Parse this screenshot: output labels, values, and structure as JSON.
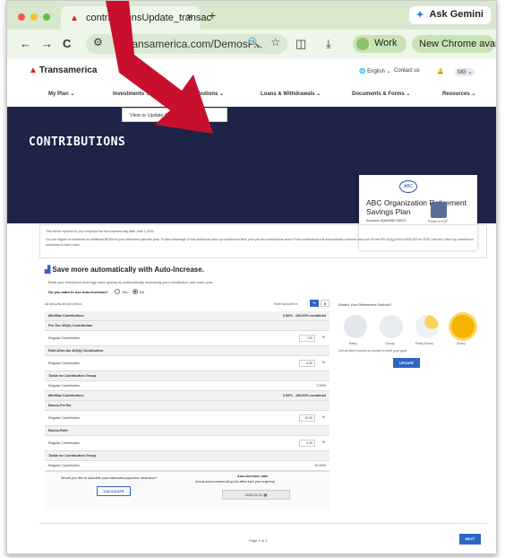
{
  "browser": {
    "tab_title": "contributionsUpdate_transac",
    "close": "×",
    "new_tab": "+",
    "url": "transamerica.com/DemosP...",
    "url_prefix": "",
    "ask_gemini": "Ask Gemini",
    "work": "Work",
    "new_chrome": "New Chrome available",
    "back": "←",
    "forward": "→",
    "reload": "C",
    "download": "⤓",
    "more": "⋮"
  },
  "header": {
    "logo": "Transamerica",
    "language": "English",
    "contact": "Contact us",
    "user": "MG"
  },
  "nav": {
    "items": [
      "My Plan",
      "Investments",
      "Contributions",
      "Loans & Withdrawals",
      "Documents & Forms",
      "Resources"
    ],
    "dropdown_item": "View or Update Contributions"
  },
  "hero": {
    "title": "CONTRIBUTIONS",
    "plan_name": "ABC Organization Retirement Savings Plan",
    "account": "Account #QA0000 00001",
    "logo_text": "ABC",
    "print": "Printer to PDF"
  },
  "notice": {
    "line1": "This will be reported to your employer the first business day after June 1,2026.",
    "line2": "You are eligible to contribute an additional $6,500 to your retirement plan this year. To take advantage of this additional catch-up contribution limit, your pre-tax contributions and/or Roth contributions will automatically continue once you hit the IRS 402(g) limit of $23,500 for 2026. Use the Catch-Up contribution worksheet to learn more."
  },
  "auto": {
    "title": "Save more automatically with Auto-Increase.",
    "desc": "Build your retirement nest egg more quickly by automatically increasing your contribution rate each year.",
    "question": "Do you want to use Auto-Increase?",
    "yes": "Yes",
    "no": "No"
  },
  "table": {
    "note": "All amounts are per period.",
    "enter_as": "Enter amounts in",
    "pct": "%",
    "dollar": "$",
    "rows": [
      {
        "type": "h",
        "label": "Min/Max Contribution:",
        "right": "0.00% - 100.00% combined"
      },
      {
        "type": "h",
        "label": "Pre-Tax 401(k) Contribution",
        "right": ""
      },
      {
        "type": "in",
        "label": "Regular Contribution",
        "value": "7.00",
        "unit": "%"
      },
      {
        "type": "h",
        "label": "Roth After-tax 401(k) Contribution",
        "right": ""
      },
      {
        "type": "in",
        "label": "Regular Contribution",
        "value": "0.00",
        "unit": "%"
      },
      {
        "type": "h",
        "label": "Totals for Contribution Group",
        "right": ""
      },
      {
        "type": "r",
        "label": "Regular Contribution",
        "right": "7.00%"
      },
      {
        "type": "h",
        "label": "Min/Max Contribution:",
        "right": "0.00% - 100.00% combined"
      },
      {
        "type": "h",
        "label": "Bonus-PreTax",
        "right": ""
      },
      {
        "type": "in",
        "label": "Regular Contribution",
        "value": "10.00",
        "unit": "%"
      },
      {
        "type": "h",
        "label": "Bonus-Roth",
        "right": ""
      },
      {
        "type": "in",
        "label": "Regular Contribution",
        "value": "0.00",
        "unit": "%"
      },
      {
        "type": "h",
        "label": "Totals for Contribution Group",
        "right": ""
      },
      {
        "type": "r",
        "label": "Regular Contribution",
        "right": "10.00%"
      }
    ]
  },
  "calc": {
    "question": "Would you like to calculate your estimated paycheck deduction?",
    "button": "CALCULATE",
    "auto_date_title": "Auto-Increase date",
    "auto_date_desc": "Annual auto increases will go into effect each year beginning:",
    "date": "2026-01-01"
  },
  "outlook": {
    "title": "What's Your Retirement Outlook?",
    "labels": [
      "Rainy",
      "Cloudy",
      "Partly Sunny",
      "Sunny"
    ],
    "goal": "Get an idea if you're on course to meet your goal.",
    "update": "UPDATE"
  },
  "footer": {
    "page": "Page 1 of 3",
    "next": "NEXT"
  },
  "colors": {
    "hero": "#1d2447",
    "accent": "#2e66c6",
    "arrow": "#c8102e"
  }
}
